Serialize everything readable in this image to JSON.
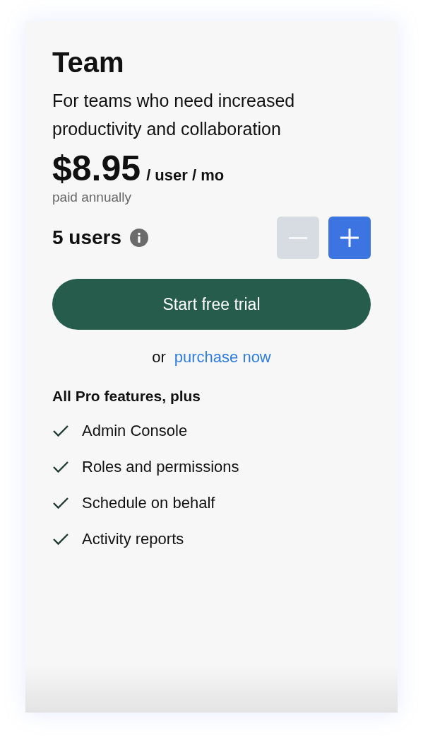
{
  "plan": {
    "title": "Team",
    "description": "For teams who need increased productivity and collaboration",
    "price": "$8.95",
    "price_unit": "/ user / mo",
    "billing_note": "paid annually"
  },
  "seats": {
    "label": "5 users",
    "buttons": [
      {
        "kind": "decrease",
        "disabled": true
      },
      {
        "kind": "increase",
        "disabled": false
      }
    ]
  },
  "cta": {
    "label": "Start free trial"
  },
  "alternative": {
    "prefix": "or",
    "link": "purchase now"
  },
  "features": {
    "heading": "All Pro features, plus",
    "items": [
      {
        "label": "Admin Console"
      },
      {
        "label": "Roles and permissions"
      },
      {
        "label": "Schedule on behalf"
      },
      {
        "label": "Activity reports"
      }
    ]
  }
}
